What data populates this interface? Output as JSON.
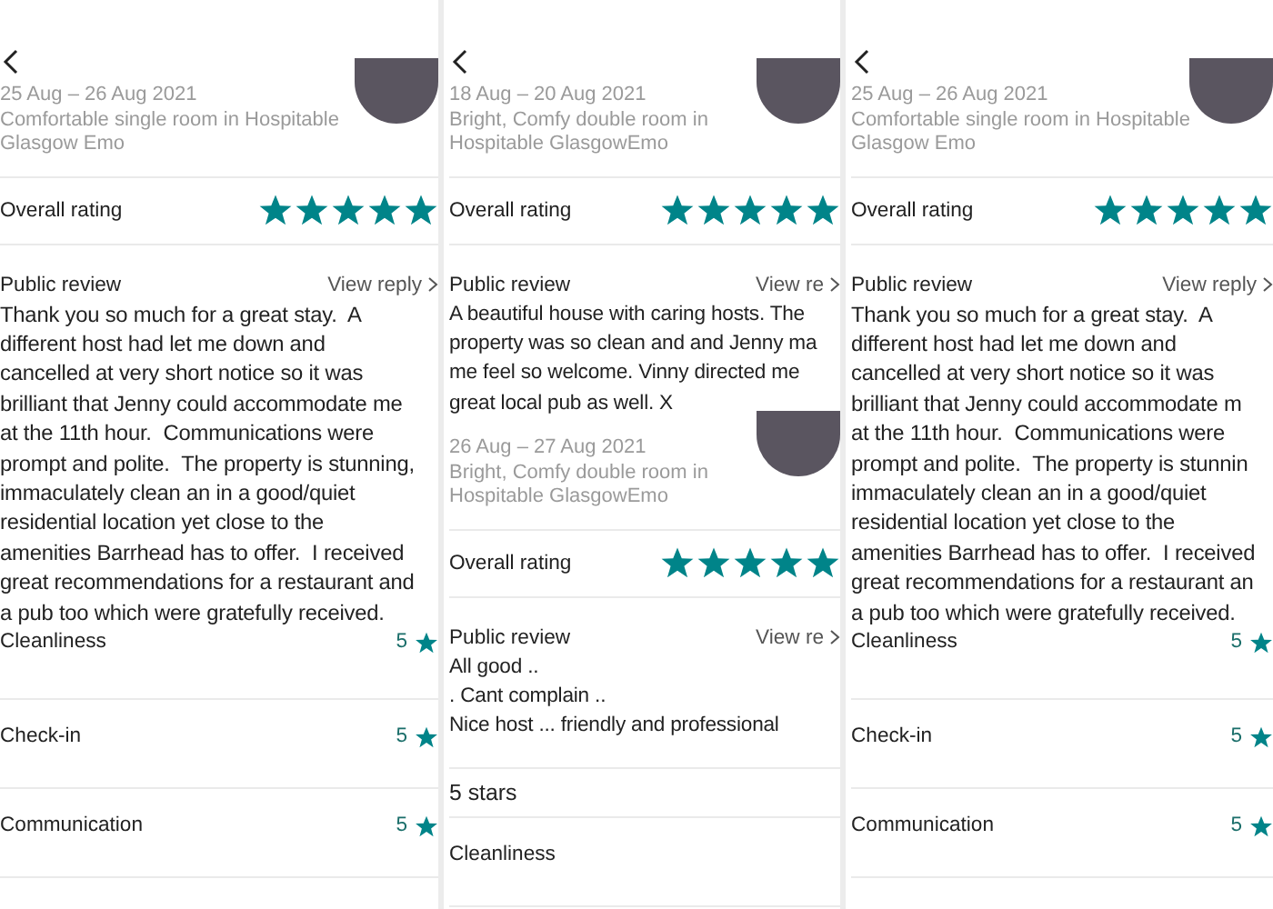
{
  "panels": [
    {
      "reviews": [
        {
          "dates": "25 Aug – 26 Aug 2021",
          "listing": "Comfortable single room in Hospitable\nGlasgow Emo",
          "rating_label": "Overall rating",
          "stars": 5,
          "review_label": "Public review",
          "view_reply": "View reply",
          "text": "Thank you so much for a great stay.  A\ndifferent host had let me down and\ncancelled at very short notice so it was\nbrilliant that Jenny could accommodate me\nat the 11th hour.  Communications were\nprompt and polite.  The property is stunning,\nimmaculately clean an in a good/quiet\nresidential location yet close to the\namenities Barrhead has to offer.  I received\ngreat recommendations for a restaurant and\na pub too which were gratefully received."
        }
      ],
      "categories": [
        {
          "label": "Cleanliness",
          "value": "5"
        },
        {
          "label": "Check-in",
          "value": "5"
        },
        {
          "label": "Communication",
          "value": "5"
        }
      ]
    },
    {
      "reviews": [
        {
          "dates": "18 Aug – 20 Aug 2021",
          "listing": "Bright, Comfy double room in\nHospitable GlasgowEmo",
          "rating_label": "Overall rating",
          "stars": 5,
          "review_label": "Public review",
          "view_reply": "View re",
          "text": "A beautiful house with caring hosts. The\nproperty was so clean and and Jenny ma\nme feel so welcome. Vinny directed me\ngreat local pub as well. X"
        },
        {
          "dates": "26 Aug – 27 Aug 2021",
          "listing": "Bright, Comfy double room in\nHospitable GlasgowEmo",
          "rating_label": "Overall rating",
          "stars": 5,
          "review_label": "Public review",
          "view_reply": "View re",
          "text": "All good ..\n. Cant complain ..\nNice host ... friendly and professional",
          "footer": "5 stars"
        }
      ],
      "categories": [
        {
          "label": "Cleanliness"
        }
      ]
    },
    {
      "reviews": [
        {
          "dates": "25 Aug – 26 Aug 2021",
          "listing": "Comfortable single room in Hospitable\nGlasgow Emo",
          "rating_label": "Overall rating",
          "stars": 5,
          "review_label": "Public review",
          "view_reply": "View reply",
          "text": "Thank you so much for a great stay.  A\ndifferent host had let me down and\ncancelled at very short notice so it was\nbrilliant that Jenny could accommodate m\nat the 11th hour.  Communications were\nprompt and polite.  The property is stunnin\nimmaculately clean an in a good/quiet\nresidential location yet close to the\namenities Barrhead has to offer.  I received\ngreat recommendations for a restaurant an\na pub too which were gratefully received."
        }
      ],
      "categories": [
        {
          "label": "Cleanliness",
          "value": "5"
        },
        {
          "label": "Check-in",
          "value": "5"
        },
        {
          "label": "Communication",
          "value": "5"
        }
      ]
    }
  ]
}
